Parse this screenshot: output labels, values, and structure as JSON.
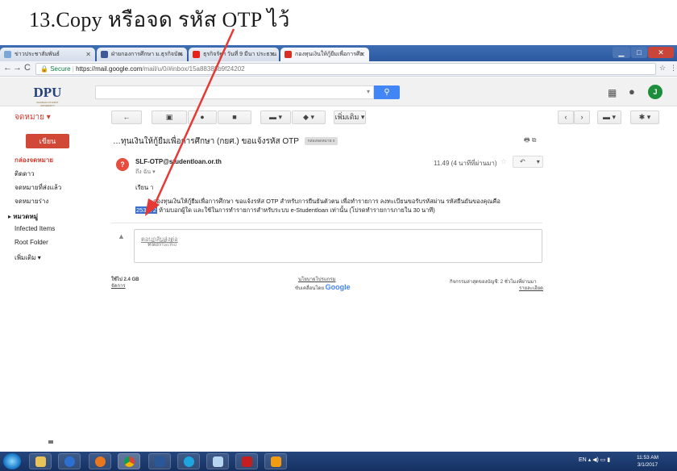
{
  "caption": "13.Copy หรือจด รหัส OTP ไว้",
  "browser": {
    "tabs": [
      {
        "label": "ข่าวประชาสัมพันธ์",
        "icon": "globe-icon",
        "color": "#7aa6d8"
      },
      {
        "label": "ฝ่ายกองการศึกษา ม.ธุรกิจบัณ",
        "icon": "facebook-icon",
        "color": "#3b5998"
      },
      {
        "label": "ธุรกิจรัฐฯ วันที่ 9 มีนา ประธาน",
        "icon": "youtube-icon",
        "color": "#e62117"
      },
      {
        "label": "กองทุนเงินให้กู้ยืมเพื่อการศึก",
        "icon": "gmail-icon",
        "color": "#d93025"
      }
    ],
    "secure_label": "Secure",
    "url_host": "https://mail.google.com",
    "url_path": "/mail/u/0/#inbox/15a88388b9f24202"
  },
  "gmail": {
    "logo_text": "DPU",
    "logo_sub": "DHURAKIJ PUNDIT UNIVERSITY",
    "mail_menu": "จดหมาย ▾",
    "toolbar_more": "เพิ่มเติม ▾",
    "compose": "เขียน",
    "sidebar": [
      "กล่องจดหมาย",
      "ติดดาว",
      "จดหมายที่ส่งแล้ว",
      "จดหมายร่าง",
      "▸ หมวดหมู่",
      "Infected Items",
      "Root Folder",
      "เพิ่มเติม ▾"
    ],
    "avatar_letter": "J"
  },
  "message": {
    "subject": "…ทุนเงินให้กู้ยืมเพื่อการศึกษา (กยศ.) ขอแจ้งรหัส OTP",
    "label": "กล่องจดหมาย x",
    "sender": "SLF-OTP@studentloan.or.th",
    "sender_initial": "?",
    "to": "ถึง ฉัน ▾",
    "time": "11.49 (4 นาทีที่ผ่านมา)",
    "greeting": "เรียน                    า",
    "body_before": "กองทุนเงินให้กู้ยืมเพื่อการศึกษา ขอแจ้งรหัส OTP สำหรับการยืนยันตัวตน เพื่อทำรายการ ลงทะเบียนขอรับรหัสผ่าน  รหัสยืนยันของคุณคือ",
    "otp": "253572",
    "body_after": " ห้ามบอกผู้ใด และใช้ในการทำรายการสำหรับระบบ e-Studentloan เท่านั้น (โปรดทำรายการภายใน 30 นาที)",
    "reply_prompt_a": "คลิกที่นี่เพื่อ",
    "reply_link": "ตอบกลับ",
    "reply_prompt_b": " หรือ",
    "forward_link": "ส่งต่อ"
  },
  "footer": {
    "usage": "ใช้ไป 2.4 GB",
    "manage": "จัดการ",
    "policy": "นโยบายโปรแกรม",
    "powered": "ขับเคลื่อนโดย",
    "google": "Google",
    "activity": "กิจกรรมล่าสุดของบัญชี: 2 ชั่วโมงที่ผ่านมา",
    "details": "รายละเอียด"
  },
  "taskbar": {
    "lang": "EN",
    "time": "11:53 AM",
    "date": "3/1/2017"
  }
}
